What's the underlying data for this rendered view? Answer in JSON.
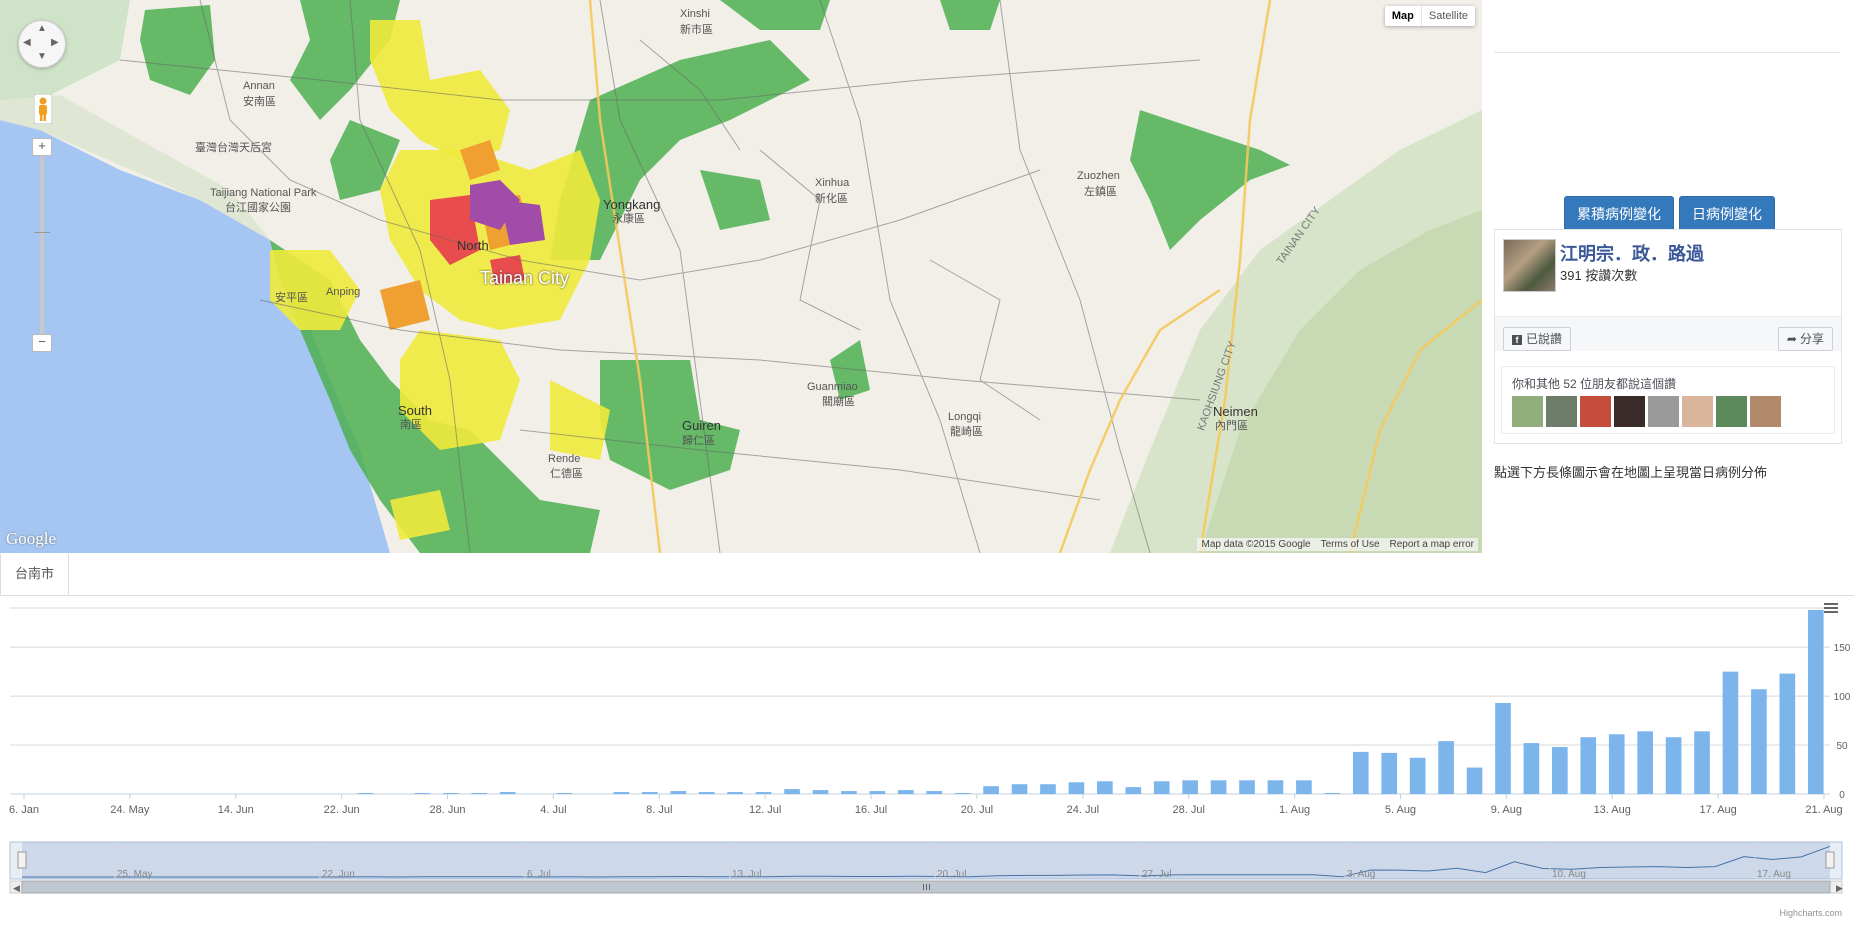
{
  "map": {
    "type_buttons": [
      "Map",
      "Satellite"
    ],
    "active_type": "Map",
    "google_logo": "Google",
    "footer": {
      "attribution": "Map data ©2015 Google",
      "terms": "Terms of Use",
      "report": "Report a map error"
    },
    "labels": [
      "Xinshi",
      "新市區",
      "Annan",
      "安南區",
      "臺灣台灣天后宮",
      "Taijiang National Park",
      "台江國家公園",
      "Yongkang",
      "永康區",
      "Xinhua",
      "新化區",
      "North",
      "Tainan City",
      "Anping",
      "安平區",
      "South",
      "南區",
      "Guiren",
      "歸仁區",
      "Rende",
      "仁德區",
      "Guanmiao",
      "關廟區",
      "Longqi",
      "龍崎區",
      "Zuozhen",
      "左鎮區",
      "Neimen",
      "內門區",
      "KAOHSIUNG CITY",
      "TAINAN CITY"
    ]
  },
  "sidebar": {
    "buttons": {
      "cumulative": "累積病例變化",
      "daily": "日病例變化"
    },
    "facebook": {
      "page_name": "江明宗．政．路過",
      "likes": "391 按讚次數",
      "liked_button": "已說讚",
      "share_button": "分享",
      "friends_text": "你和其他 52 位朋友都說這個讚"
    },
    "note": "點選下方長條圖示會在地圖上呈現當日病例分佈"
  },
  "tabs": [
    {
      "label": "台南市",
      "active": true
    }
  ],
  "chart_data": {
    "type": "bar",
    "color": "#7cb5ec",
    "x_tick_labels": [
      "6. Jan",
      "24. May",
      "14. Jun",
      "22. Jun",
      "28. Jun",
      "4. Jul",
      "8. Jul",
      "12. Jul",
      "16. Jul",
      "20. Jul",
      "24. Jul",
      "28. Jul",
      "1. Aug",
      "5. Aug",
      "9. Aug",
      "13. Aug",
      "17. Aug",
      "21. Aug"
    ],
    "y_tick_labels": [
      "0",
      "50",
      "100",
      "150"
    ],
    "ylim": [
      0,
      190
    ],
    "grid": true,
    "y_axis_side": "right",
    "values": [
      0,
      0,
      0,
      0,
      0,
      0,
      0,
      0,
      0,
      0,
      0,
      0,
      1,
      0,
      1,
      1,
      1,
      2,
      0,
      1,
      0,
      2,
      2,
      3,
      2,
      2,
      2,
      5,
      4,
      3,
      3,
      4,
      3,
      1,
      8,
      10,
      10,
      12,
      13,
      7,
      13,
      14,
      14,
      14,
      14,
      14,
      1,
      43,
      42,
      37,
      54,
      27,
      93,
      52,
      48,
      58,
      61,
      64,
      58,
      64,
      125,
      107,
      123,
      188
    ],
    "navigator": {
      "labels": [
        "25. May",
        "22. Jun",
        "6. Jul",
        "13. Jul",
        "20. Jul",
        "27. Jul",
        "3. Aug",
        "10. Aug",
        "17. Aug"
      ]
    },
    "credits": "Highcharts.com"
  }
}
